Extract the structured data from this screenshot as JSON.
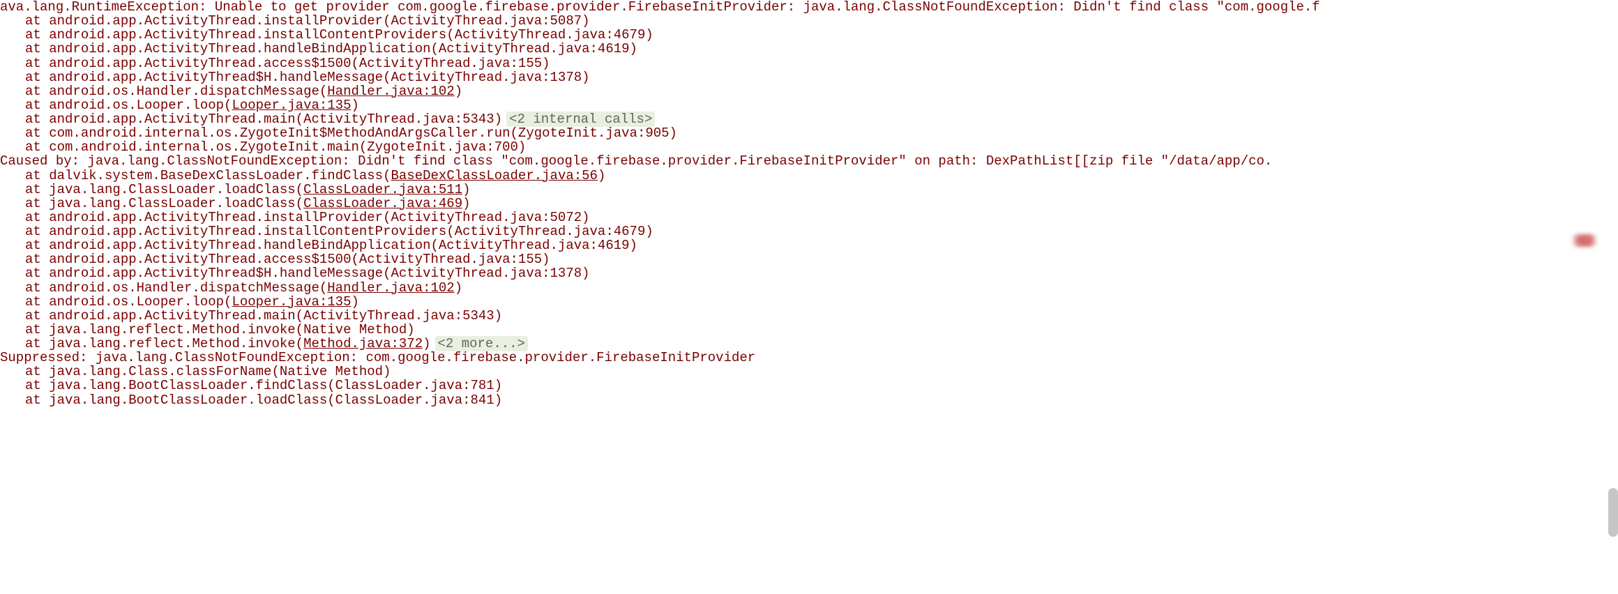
{
  "exception_line": "ava.lang.RuntimeException: Unable to get provider com.google.firebase.provider.FirebaseInitProvider: java.lang.ClassNotFoundException: Didn't find class \"com.google.f",
  "frames1": [
    {
      "pre": "at android.app.ActivityThread.installProvider(ActivityThread.java:5087)"
    },
    {
      "pre": "at android.app.ActivityThread.installContentProviders(ActivityThread.java:4679)"
    },
    {
      "pre": "at android.app.ActivityThread.handleBindApplication(ActivityThread.java:4619)"
    },
    {
      "pre": "at android.app.ActivityThread.access$1500(ActivityThread.java:155)"
    },
    {
      "pre": "at android.app.ActivityThread$H.handleMessage(ActivityThread.java:1378)"
    },
    {
      "pre": "at android.os.Handler.dispatchMessage(",
      "link": "Handler.java:102",
      "post": ")"
    },
    {
      "pre": "at android.os.Looper.loop(",
      "link": "Looper.java:135",
      "post": ")"
    },
    {
      "pre": "at android.app.ActivityThread.main(ActivityThread.java:5343)",
      "note": "<2 internal calls>"
    },
    {
      "pre": "at com.android.internal.os.ZygoteInit$MethodAndArgsCaller.run(ZygoteInit.java:905)"
    },
    {
      "pre": "at com.android.internal.os.ZygoteInit.main(ZygoteInit.java:700)"
    }
  ],
  "caused_by": "Caused by: java.lang.ClassNotFoundException: Didn't find class \"com.google.firebase.provider.FirebaseInitProvider\" on path: DexPathList[[zip file \"/data/app/co.",
  "frames2": [
    {
      "pre": "at dalvik.system.BaseDexClassLoader.findClass(",
      "link": "BaseDexClassLoader.java:56",
      "post": ")"
    },
    {
      "pre": "at java.lang.ClassLoader.loadClass(",
      "link": "ClassLoader.java:511",
      "post": ")"
    },
    {
      "pre": "at java.lang.ClassLoader.loadClass(",
      "link": "ClassLoader.java:469",
      "post": ")"
    },
    {
      "pre": "at android.app.ActivityThread.installProvider(ActivityThread.java:5072)"
    },
    {
      "pre": "at android.app.ActivityThread.installContentProviders(ActivityThread.java:4679)"
    },
    {
      "pre": "at android.app.ActivityThread.handleBindApplication(ActivityThread.java:4619)"
    },
    {
      "pre": "at android.app.ActivityThread.access$1500(ActivityThread.java:155)"
    },
    {
      "pre": "at android.app.ActivityThread$H.handleMessage(ActivityThread.java:1378)"
    },
    {
      "pre": "at android.os.Handler.dispatchMessage(",
      "link": "Handler.java:102",
      "post": ")"
    },
    {
      "pre": "at android.os.Looper.loop(",
      "link": "Looper.java:135",
      "post": ")"
    },
    {
      "pre": "at android.app.ActivityThread.main(ActivityThread.java:5343)"
    },
    {
      "pre": "at java.lang.reflect.Method.invoke(Native Method)"
    },
    {
      "pre": "at java.lang.reflect.Method.invoke(",
      "link": "Method.java:372",
      "post": ")",
      "note": "<2 more...>"
    }
  ],
  "suppressed": "Suppressed: java.lang.ClassNotFoundException: com.google.firebase.provider.FirebaseInitProvider",
  "frames3": [
    {
      "pre": "at java.lang.Class.classForName(Native Method)"
    },
    {
      "pre": "at java.lang.BootClassLoader.findClass(ClassLoader.java:781)"
    },
    {
      "pre": "at java.lang.BootClassLoader.loadClass(ClassLoader.java:841)"
    }
  ]
}
